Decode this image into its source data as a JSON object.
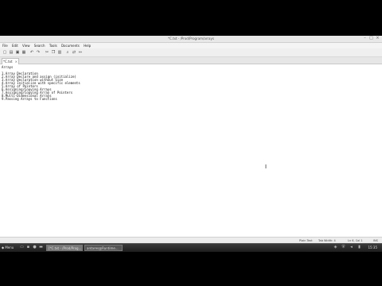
{
  "window": {
    "title": "*C.txt - /Prod/Program/arrays"
  },
  "menubar": {
    "items": [
      "File",
      "Edit",
      "View",
      "Search",
      "Tools",
      "Documents",
      "Help"
    ]
  },
  "tab": {
    "label": "*C.txt",
    "close": "×"
  },
  "editor": {
    "lines": [
      "Arrays",
      "",
      "1.Array Declaration",
      "2.Array Declare and assign (initialize)",
      "3.Array Declaration without Size",
      "4.Array Initialize with specific elements",
      "5.Array of Pointers",
      "6.Assigning/Copying Arrays",
      "7.Assigning/Copying Array of Pointers",
      "8.Multi-Dimensional Arrays",
      "9.Passing Arrays to Functions"
    ]
  },
  "statusbar": {
    "lang": "Plain Text",
    "tabwidth": "Tab Width: 4",
    "position": "Ln 6, Col 1",
    "mode": "INS"
  },
  "taskbar": {
    "menu_label": "Menu",
    "tasks": [
      "[*C.txt - /Prod/Prog...",
      "antares@Runtime..."
    ],
    "clock": "15:35"
  }
}
